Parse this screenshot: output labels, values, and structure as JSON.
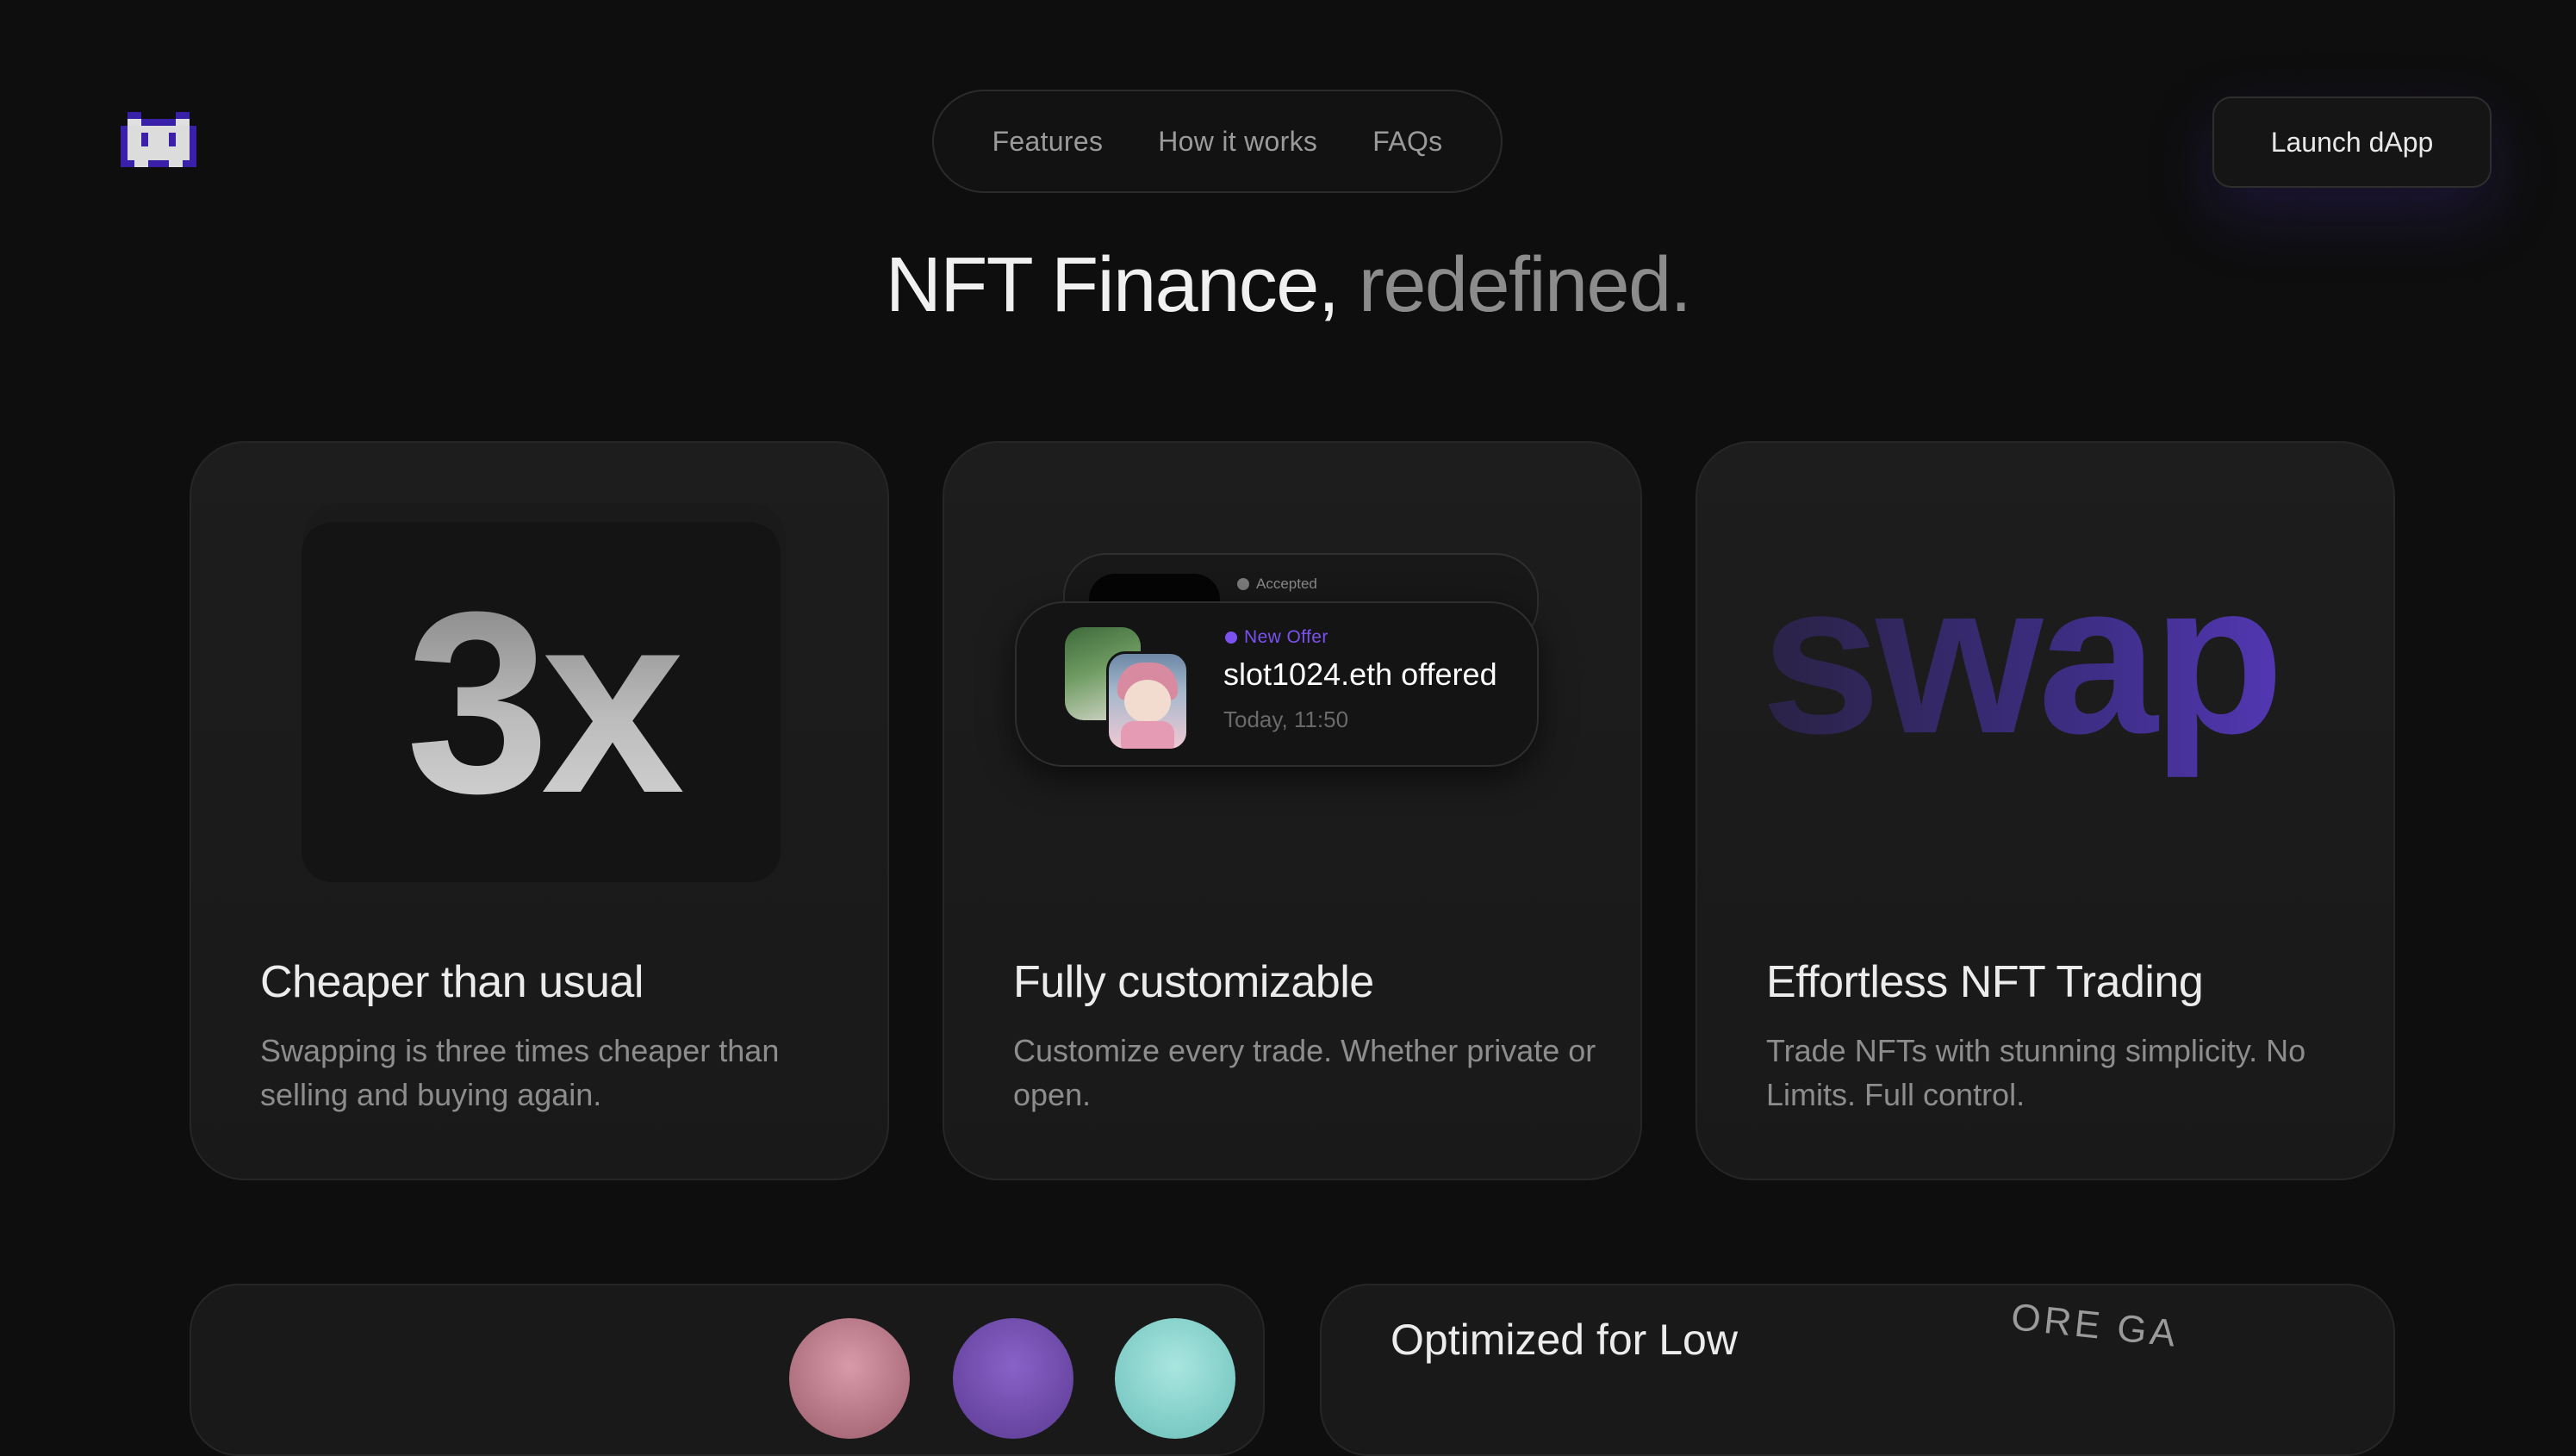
{
  "nav": {
    "links": [
      "Features",
      "How it works",
      "FAQs"
    ],
    "cta": "Launch dApp"
  },
  "hero": {
    "part1": "NFT Finance, ",
    "part2": "redefined."
  },
  "cards": [
    {
      "visual_text": "3x",
      "title": "Cheaper than usual",
      "description": "Swapping is three times cheaper than selling and buying again."
    },
    {
      "back_status": "Accepted",
      "front_status": "New Offer",
      "offer_text": "slot1024.eth offered",
      "time": "Today, 11:50",
      "title": "Fully customizable",
      "description": "Customize every trade. Whether private or open."
    },
    {
      "visual_text": "swap",
      "title": "Effortless NFT Trading",
      "description": "Trade NFTs with stunning simplicity. No Limits. Full control."
    }
  ],
  "bottom": {
    "title": "Optimized for Low",
    "stamp_text": "ORE GA"
  },
  "colors": {
    "background": "#0e0e0e",
    "accent": "#7b52f0",
    "card": "#1b1b1b"
  }
}
